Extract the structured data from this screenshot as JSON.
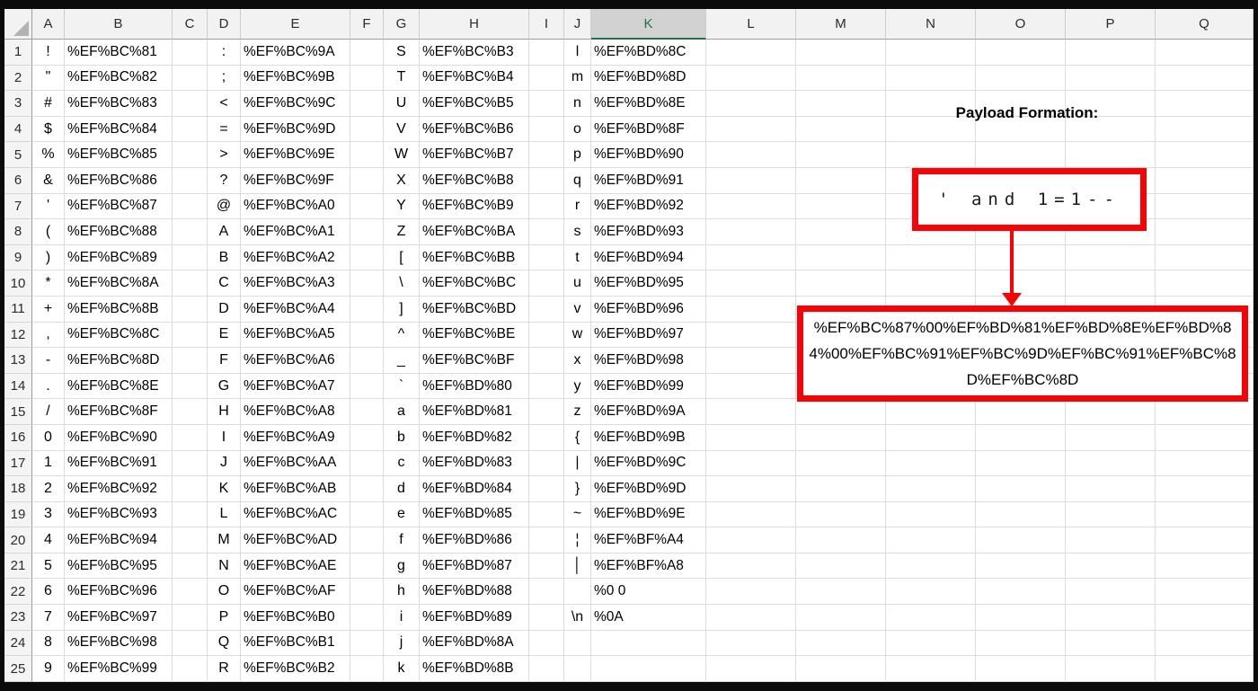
{
  "colors": {
    "highlight_red": "#fb0005",
    "selected_header_green": "#217346",
    "selected_header_bg": "#d2d2d2",
    "header_bg": "#f2f2f2",
    "gridline": "#dcdcdc"
  },
  "annotation": {
    "title": "Payload Formation:",
    "payload_plain": "' and 1=1--",
    "payload_encoded": "%EF%BC%87%00%EF%BD%81%EF%BD%8E%EF%BD%84%00%EF%BC%91%EF%BC%9D%EF%BC%91%EF%BC%8D%EF%BC%8D"
  },
  "sheet": {
    "columns": [
      "A",
      "B",
      "C",
      "D",
      "E",
      "F",
      "G",
      "H",
      "I",
      "J",
      "K",
      "L",
      "M",
      "N",
      "O",
      "P",
      "Q"
    ],
    "selected_column": "K",
    "char_columns": [
      "A",
      "D",
      "G",
      "J"
    ],
    "encoding_columns": [
      "B",
      "E",
      "H",
      "K"
    ],
    "row_count": 25,
    "rows": [
      {
        "n": 1,
        "A": "!",
        "B": "%EF%BC%81",
        "D": ":",
        "E": "%EF%BC%9A",
        "G": "S",
        "H": "%EF%BC%B3",
        "J": "l",
        "K": "%EF%BD%8C"
      },
      {
        "n": 2,
        "A": "\"",
        "B": "%EF%BC%82",
        "D": ";",
        "E": "%EF%BC%9B",
        "G": "T",
        "H": "%EF%BC%B4",
        "J": "m",
        "K": "%EF%BD%8D"
      },
      {
        "n": 3,
        "A": "#",
        "B": "%EF%BC%83",
        "D": "<",
        "E": "%EF%BC%9C",
        "G": "U",
        "H": "%EF%BC%B5",
        "J": "n",
        "K": "%EF%BD%8E"
      },
      {
        "n": 4,
        "A": "$",
        "B": "%EF%BC%84",
        "D": "=",
        "E": "%EF%BC%9D",
        "G": "V",
        "H": "%EF%BC%B6",
        "J": "o",
        "K": "%EF%BD%8F"
      },
      {
        "n": 5,
        "A": "%",
        "B": "%EF%BC%85",
        "D": ">",
        "E": "%EF%BC%9E",
        "G": "W",
        "H": "%EF%BC%B7",
        "J": "p",
        "K": "%EF%BD%90"
      },
      {
        "n": 6,
        "A": "&",
        "B": "%EF%BC%86",
        "D": "?",
        "E": "%EF%BC%9F",
        "G": "X",
        "H": "%EF%BC%B8",
        "J": "q",
        "K": "%EF%BD%91"
      },
      {
        "n": 7,
        "A": "'",
        "B": "%EF%BC%87",
        "D": "@",
        "E": "%EF%BC%A0",
        "G": "Y",
        "H": "%EF%BC%B9",
        "J": "r",
        "K": "%EF%BD%92"
      },
      {
        "n": 8,
        "A": "(",
        "B": "%EF%BC%88",
        "D": "A",
        "E": "%EF%BC%A1",
        "G": "Z",
        "H": "%EF%BC%BA",
        "J": "s",
        "K": "%EF%BD%93"
      },
      {
        "n": 9,
        "A": ")",
        "B": "%EF%BC%89",
        "D": "B",
        "E": "%EF%BC%A2",
        "G": "[",
        "H": "%EF%BC%BB",
        "J": "t",
        "K": "%EF%BD%94"
      },
      {
        "n": 10,
        "A": "*",
        "B": "%EF%BC%8A",
        "D": "C",
        "E": "%EF%BC%A3",
        "G": "\\",
        "H": "%EF%BC%BC",
        "J": "u",
        "K": "%EF%BD%95"
      },
      {
        "n": 11,
        "A": "+",
        "B": "%EF%BC%8B",
        "D": "D",
        "E": "%EF%BC%A4",
        "G": "]",
        "H": "%EF%BC%BD",
        "J": "v",
        "K": "%EF%BD%96"
      },
      {
        "n": 12,
        "A": ",",
        "B": "%EF%BC%8C",
        "D": "E",
        "E": "%EF%BC%A5",
        "G": "^",
        "H": "%EF%BC%BE",
        "J": "w",
        "K": "%EF%BD%97"
      },
      {
        "n": 13,
        "A": "-",
        "B": "%EF%BC%8D",
        "D": "F",
        "E": "%EF%BC%A6",
        "G": "_",
        "H": "%EF%BC%BF",
        "J": "x",
        "K": "%EF%BD%98"
      },
      {
        "n": 14,
        "A": ".",
        "B": "%EF%BC%8E",
        "D": "G",
        "E": "%EF%BC%A7",
        "G": "`",
        "H": "%EF%BD%80",
        "J": "y",
        "K": "%EF%BD%99"
      },
      {
        "n": 15,
        "A": "/",
        "B": "%EF%BC%8F",
        "D": "H",
        "E": "%EF%BC%A8",
        "G": "a",
        "H": "%EF%BD%81",
        "J": "z",
        "K": "%EF%BD%9A"
      },
      {
        "n": 16,
        "A": "0",
        "B": "%EF%BC%90",
        "D": "I",
        "E": "%EF%BC%A9",
        "G": "b",
        "H": "%EF%BD%82",
        "J": "{",
        "K": "%EF%BD%9B"
      },
      {
        "n": 17,
        "A": "1",
        "B": "%EF%BC%91",
        "D": "J",
        "E": "%EF%BC%AA",
        "G": "c",
        "H": "%EF%BD%83",
        "J": "|",
        "K": "%EF%BD%9C"
      },
      {
        "n": 18,
        "A": "2",
        "B": "%EF%BC%92",
        "D": "K",
        "E": "%EF%BC%AB",
        "G": "d",
        "H": "%EF%BD%84",
        "J": "}",
        "K": "%EF%BD%9D"
      },
      {
        "n": 19,
        "A": "3",
        "B": "%EF%BC%93",
        "D": "L",
        "E": "%EF%BC%AC",
        "G": "e",
        "H": "%EF%BD%85",
        "J": "~",
        "K": "%EF%BD%9E"
      },
      {
        "n": 20,
        "A": "4",
        "B": "%EF%BC%94",
        "D": "M",
        "E": "%EF%BC%AD",
        "G": "f",
        "H": "%EF%BD%86",
        "J": "¦",
        "K": "%EF%BF%A4"
      },
      {
        "n": 21,
        "A": "5",
        "B": "%EF%BC%95",
        "D": "N",
        "E": "%EF%BC%AE",
        "G": "g",
        "H": "%EF%BD%87",
        "J": "│",
        "K": "%EF%BF%A8"
      },
      {
        "n": 22,
        "A": "6",
        "B": "%EF%BC%96",
        "D": "O",
        "E": "%EF%BC%AF",
        "G": "h",
        "H": "%EF%BD%88",
        "J": "",
        "K": "%0 0"
      },
      {
        "n": 23,
        "A": "7",
        "B": "%EF%BC%97",
        "D": "P",
        "E": "%EF%BC%B0",
        "G": "i",
        "H": "%EF%BD%89",
        "J": "\\n",
        "K": "%0A"
      },
      {
        "n": 24,
        "A": "8",
        "B": "%EF%BC%98",
        "D": "Q",
        "E": "%EF%BC%B1",
        "G": "j",
        "H": "%EF%BD%8A",
        "J": "",
        "K": ""
      },
      {
        "n": 25,
        "A": "9",
        "B": "%EF%BC%99",
        "D": "R",
        "E": "%EF%BC%B2",
        "G": "k",
        "H": "%EF%BD%8B",
        "J": "",
        "K": ""
      }
    ]
  }
}
